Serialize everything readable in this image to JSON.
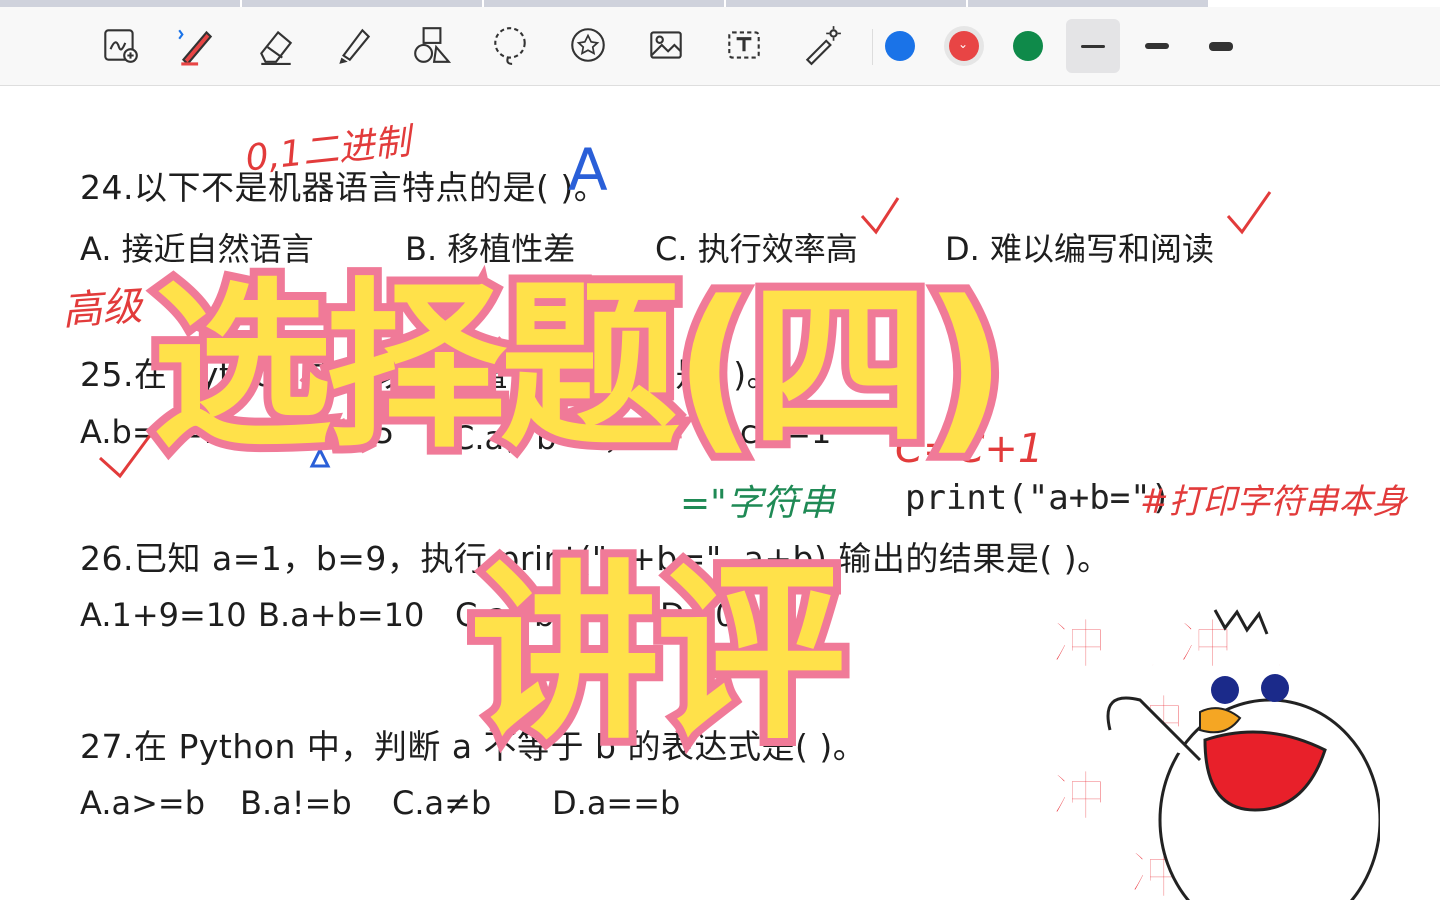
{
  "toolbar": {
    "tools": [
      "notes-add-icon",
      "pen-icon",
      "eraser-icon",
      "highlighter-icon",
      "shapes-icon",
      "lasso-icon",
      "sticker-icon",
      "image-icon",
      "text-icon",
      "laser-pointer-icon"
    ],
    "colors": [
      "#1a73e8",
      "#e84545",
      "#0f8a4a"
    ],
    "selected_color": "#e84545"
  },
  "questions": [
    {
      "stem": "24.以下不是机器语言特点的是(      )。",
      "options": [
        "A. 接近自然语言",
        "B. 移植性差",
        "C. 执行效率高",
        "D. 难以编写和阅读"
      ]
    },
    {
      "stem": "25.在 Python 中，以下赋值语句正确的是(      )。",
      "options": [
        "A.b=c=10",
        "B.3a=5",
        "C.a，b=1，2",
        "D.c+=1"
      ]
    },
    {
      "stem": "26.已知 a=1，b=9，执行 print(\"a+b=\", a+b) 输出的结果是(      )。",
      "options": [
        "A.1+9=10",
        "B.a+b=10",
        "C.a+b=",
        "D.10"
      ]
    },
    {
      "stem": "27.在 Python 中，判断 a 不等于 b 的表达式是(      )。",
      "options": [
        "A.a>=b",
        "B.a!=b",
        "C.a≠b",
        "D.a==b"
      ]
    }
  ],
  "annotations": {
    "binary_note": "0,1二进制",
    "answer_24": "A",
    "high_level": "高级",
    "c_plus": "C=C+1",
    "string_note": "=\"字符串",
    "print_code": "print(\"a+b=\")",
    "print_note": "#打印字符串本身"
  },
  "overlay": {
    "title": "选择题(四)",
    "subtitle": "讲评"
  },
  "sticker": {
    "text_row1": "冲鸭 冲鸭",
    "text_left": "冲",
    "text_left2": "冲鸭",
    "text_left3": "冲"
  }
}
